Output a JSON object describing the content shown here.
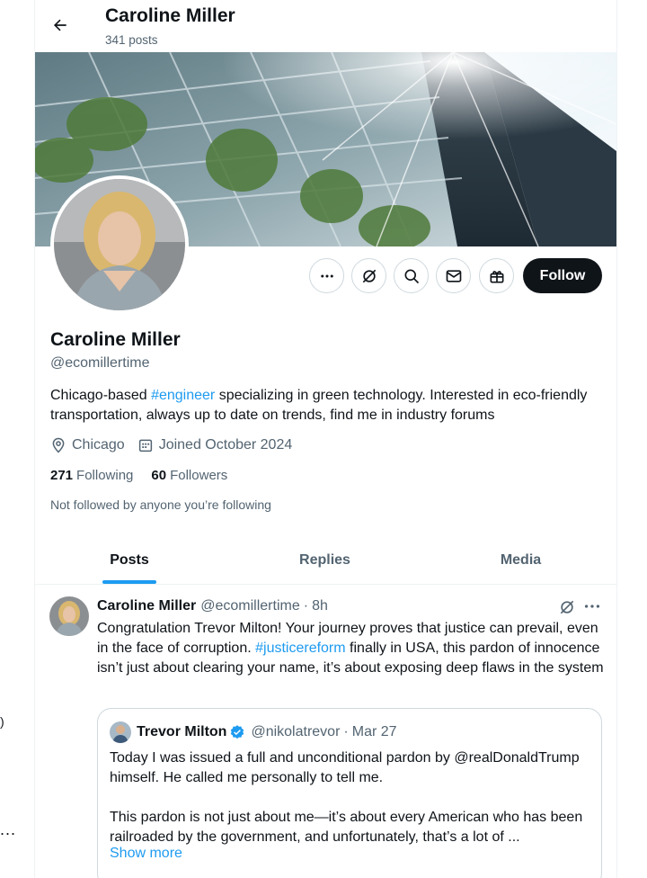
{
  "header": {
    "title": "Caroline Miller",
    "post_count": "341 posts",
    "back_icon": "arrow-left-icon"
  },
  "profile": {
    "name": "Caroline Miller",
    "handle": "@ecomillertime",
    "bio_before": "Chicago-based ",
    "bio_link": "#engineer",
    "bio_after": " specializing in green technology. Interested in eco-friendly transportation, always up to date on trends, find me in industry forums",
    "location": "Chicago",
    "joined": "Joined October 2024",
    "following_count": "271",
    "following_label": "Following",
    "followers_count": "60",
    "followers_label": "Followers",
    "not_followed": "Not followed by anyone you’re following"
  },
  "actions": {
    "icons": [
      "more-icon",
      "grok-icon",
      "search-icon",
      "message-icon",
      "gift-icon"
    ],
    "follow_label": "Follow"
  },
  "tabs": [
    {
      "label": "Posts",
      "active": true
    },
    {
      "label": "Replies",
      "active": false
    },
    {
      "label": "Media",
      "active": false
    }
  ],
  "post": {
    "author": "Caroline Miller",
    "handle": "@ecomillertime",
    "dot": "·",
    "time": "8h",
    "text_before": "Congratulation Trevor Milton! Your journey proves that justice can prevail, even in the face of corruption. ",
    "text_link": "#justicereform",
    "text_after": " finally in USA, this pardon of innocence isn’t just about clearing your name, it’s about exposing deep flaws in the system",
    "quote": {
      "author": "Trevor Milton",
      "handle": "@nikolatrevor",
      "dot": "·",
      "date": "Mar 27",
      "text": "Today I was issued a full and unconditional pardon by @realDonaldTrump himself. He called me personally to tell me.\n\nThis pardon is not just about me—it’s about every American who has been railroaded by the government, and unfortunately, that’s a lot of ...",
      "show_more": "Show more"
    }
  },
  "edge": {
    "ellipsis": "...",
    "paren": ")"
  },
  "colors": {
    "accent": "#1d9bf0",
    "text": "#0f1419",
    "muted": "#536471",
    "border": "#cfd9de"
  }
}
